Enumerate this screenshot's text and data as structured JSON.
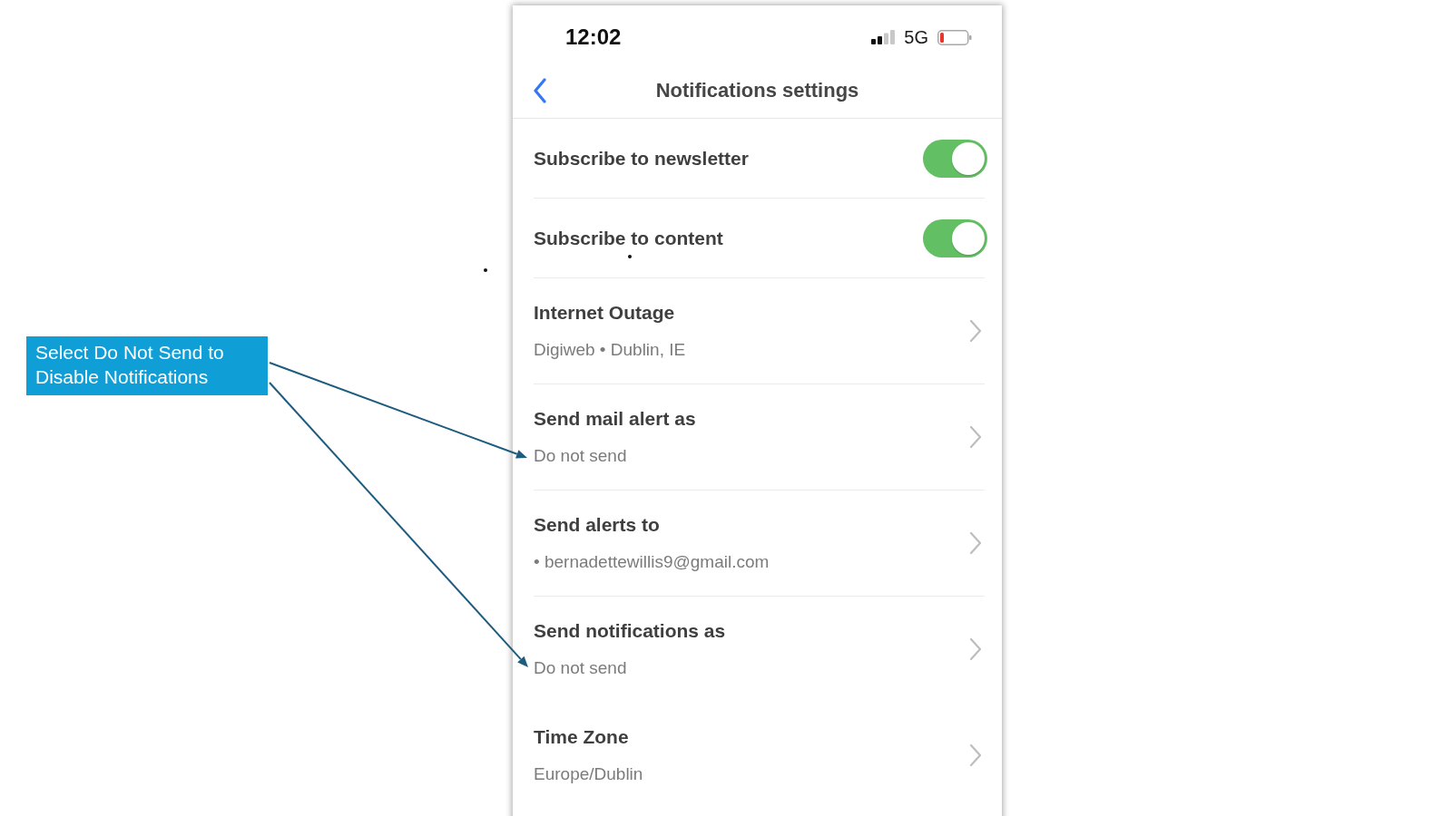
{
  "status_bar": {
    "time": "12:02",
    "network": "5G"
  },
  "header": {
    "title": "Notifications settings"
  },
  "settings": [
    {
      "kind": "toggle",
      "label": "Subscribe to newsletter",
      "on": true,
      "divider": true
    },
    {
      "kind": "toggle",
      "label": "Subscribe to content",
      "on": true,
      "divider": true
    },
    {
      "kind": "link",
      "label": "Internet Outage",
      "value": "Digiweb • Dublin, IE",
      "divider": true
    },
    {
      "kind": "link",
      "label": "Send mail alert as",
      "value": "Do not send",
      "divider": true
    },
    {
      "kind": "link",
      "label": "Send alerts to",
      "value": "• bernadettewillis9@gmail.com",
      "divider": true
    },
    {
      "kind": "link",
      "label": "Send notifications as",
      "value": "Do not send",
      "divider": false
    },
    {
      "kind": "link",
      "label": "Time Zone",
      "value": "Europe/Dublin",
      "divider": false
    }
  ],
  "callout": {
    "text": "Select Do Not Send to Disable Notifications"
  }
}
